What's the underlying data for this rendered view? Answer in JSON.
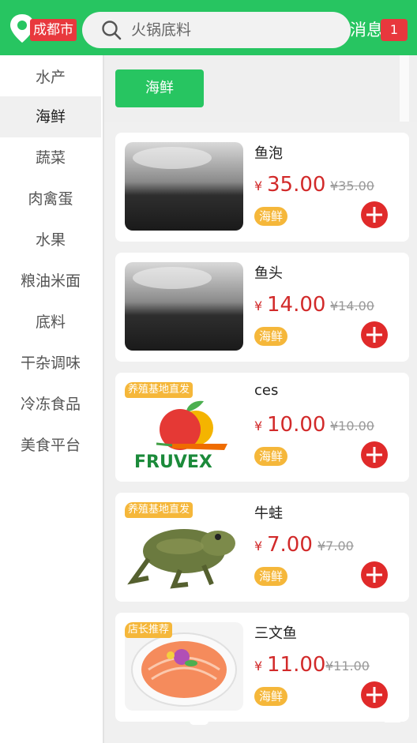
{
  "header": {
    "city": "成都市",
    "search_placeholder": "火锅底料",
    "message_label": "消息",
    "message_count": "1"
  },
  "sidebar": {
    "items": [
      {
        "label": "水产"
      },
      {
        "label": "海鲜"
      },
      {
        "label": "蔬菜"
      },
      {
        "label": "肉禽蛋"
      },
      {
        "label": "水果"
      },
      {
        "label": "粮油米面"
      },
      {
        "label": "底料"
      },
      {
        "label": "干杂调味"
      },
      {
        "label": "冷冻食品"
      },
      {
        "label": "美食平台"
      }
    ],
    "active_index": 1
  },
  "subcategory": {
    "label": "海鲜"
  },
  "products": [
    {
      "name": "鱼泡",
      "currency": "¥",
      "price": "35.00",
      "old_price": "¥35.00",
      "category": "海鲜",
      "badge": "",
      "image": "blurry-fish-photo"
    },
    {
      "name": "鱼头",
      "currency": "¥",
      "price": "14.00",
      "old_price": "¥14.00",
      "category": "海鲜",
      "badge": "",
      "image": "blurry-fish-photo"
    },
    {
      "name": "ces",
      "currency": "¥",
      "price": "10.00",
      "old_price": "¥10.00",
      "category": "海鲜",
      "badge": "养殖基地直发",
      "image": "fruvex-logo"
    },
    {
      "name": "牛蛙",
      "currency": "¥",
      "price": "7.00",
      "old_price": "¥7.00",
      "category": "海鲜",
      "badge": "养殖基地直发",
      "image": "bullfrog-photo"
    },
    {
      "name": "三文鱼",
      "currency": "¥",
      "price": "11.00",
      "old_price": "¥11.00",
      "category": "海鲜",
      "badge": "店长推荐",
      "image": "salmon-platter-photo"
    }
  ],
  "colors": {
    "brand_green": "#27c561",
    "price_red": "#d22a2a",
    "tag_orange": "#f5b73a",
    "badge_red": "#e8383d"
  }
}
